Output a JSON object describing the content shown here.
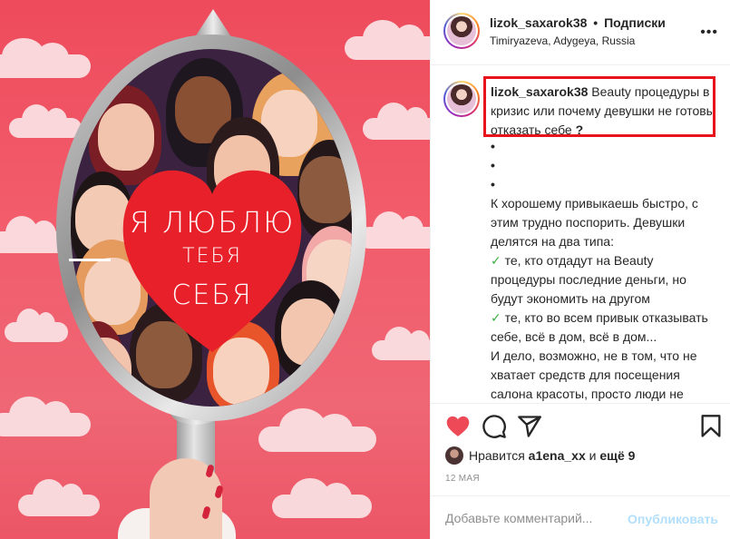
{
  "post": {
    "image_text": {
      "line1": "Я ЛЮБЛЮ",
      "line2": "ТЕБЯ",
      "line3": "СЕБЯ"
    }
  },
  "header": {
    "username": "lizok_saxarok38",
    "separator": "•",
    "follow_label": "Подписки",
    "location": "Timiryazeva, Adygeya, Russia",
    "more_icon": "more-horizontal-icon"
  },
  "caption": {
    "username": "lizok_saxarok38",
    "title_text": "Beauty процедуры в кризис или почему девушки не готовы отказать себе",
    "title_mark": "?",
    "bullets": [
      "•",
      "•",
      "•"
    ],
    "lines": [
      "К хорошему привыкаешь быстро, с этим трудно поспорить. Девушки делятся на два типа:"
    ],
    "checks": [
      {
        "mark": "✓",
        "text": "те, кто отдадут на Beauty процедуры последние деньги, но будут экономить на другом"
      },
      {
        "mark": "✓",
        "text": "те, кто во всем привык отказывать себе, всё в дом, всё в дом..."
      }
    ],
    "closing": "И дело, возможно, не в том, что не хватает средств для посещения салона красоты, просто люди не привыкли тратить на себя деньги и время, а значит вкладывать в себя!"
  },
  "actions": {
    "like_icon": "heart-filled-icon",
    "comment_icon": "comment-icon",
    "share_icon": "send-icon",
    "save_icon": "bookmark-icon",
    "like_color": "#ed4956"
  },
  "likes": {
    "prefix": "Нравится",
    "user": "a1ena_xx",
    "and": "и",
    "others": "ещё 9"
  },
  "date": "12 МАЯ",
  "comment": {
    "placeholder": "Добавьте комментарий...",
    "publish_label": "Опубликовать"
  }
}
